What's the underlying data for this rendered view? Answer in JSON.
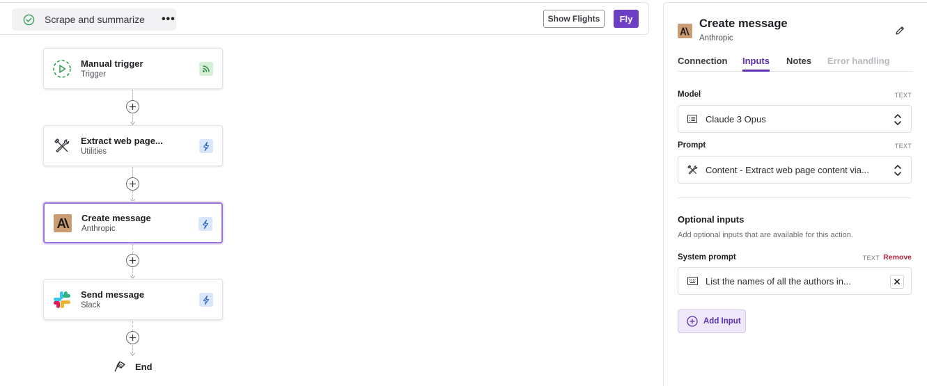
{
  "header": {
    "flow_name": "Scrape and summarize",
    "more_label": "•••",
    "show_flights_label": "Show Flights",
    "fly_label": "Fly"
  },
  "nodes": [
    {
      "title": "Manual trigger",
      "subtitle": "Trigger",
      "icon": "play-trigger-icon",
      "badge": "rss-icon",
      "badge_color": "#d5f0d6"
    },
    {
      "title": "Extract web page...",
      "subtitle": "Utilities",
      "icon": "tools-icon",
      "badge": "bolt-icon",
      "badge_color": "#d9e6fb"
    },
    {
      "title": "Create message",
      "subtitle": "Anthropic",
      "icon": "anthropic-logo-icon",
      "badge": "bolt-icon",
      "badge_color": "#d9e6fb",
      "selected": true
    },
    {
      "title": "Send message",
      "subtitle": "Slack",
      "icon": "slack-logo-icon",
      "badge": "bolt-icon",
      "badge_color": "#d9e6fb"
    }
  ],
  "end_label": "End",
  "panel": {
    "title": "Create message",
    "subtitle": "Anthropic",
    "tabs": [
      {
        "label": "Connection",
        "state": "normal"
      },
      {
        "label": "Inputs",
        "state": "active"
      },
      {
        "label": "Notes",
        "state": "normal"
      },
      {
        "label": "Error handling",
        "state": "disabled"
      }
    ],
    "model": {
      "label": "Model",
      "type": "TEXT",
      "value": "Claude 3 Opus",
      "icon": "list-icon"
    },
    "prompt": {
      "label": "Prompt",
      "type": "TEXT",
      "value": "Content - Extract web page content via...",
      "icon": "tools-icon"
    },
    "optional": {
      "title": "Optional inputs",
      "description": "Add optional inputs that are available for this action."
    },
    "system_prompt": {
      "label": "System prompt",
      "type": "TEXT",
      "remove_label": "Remove",
      "value": "List the names of all the authors in...",
      "icon": "keyboard-icon"
    },
    "add_input_label": "Add Input"
  },
  "colors": {
    "accent": "#5a2fb0",
    "fly_button": "#6d3fc4",
    "selected_border": "#9a73d6",
    "anthropic_brand": "#c99c74",
    "remove": "#b2223a"
  }
}
